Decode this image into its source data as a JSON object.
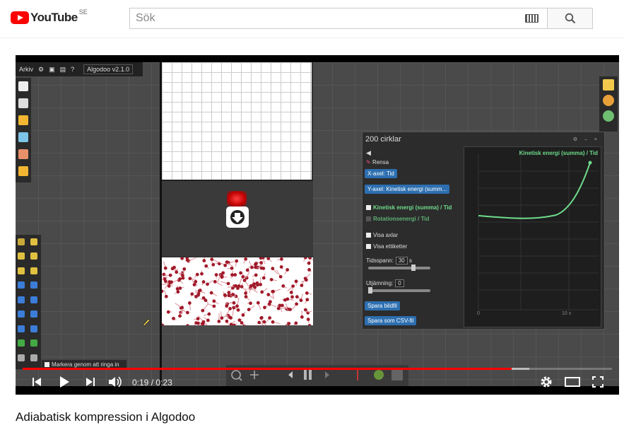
{
  "header": {
    "logo_text": "YouTube",
    "region": "SE",
    "search_placeholder": "Sök"
  },
  "video": {
    "title": "Adiabatisk kompression i Algodoo",
    "current_time": "0:19",
    "duration": "0:23",
    "time_separator": "/",
    "progress_fraction": 0.83,
    "buffered_fraction": 0.86,
    "colors": {
      "progress": "#ff0000",
      "brand": "#ff0000"
    }
  },
  "algodoo": {
    "menu_label": "Arkiv",
    "version": "Algodoo v2.1.0",
    "marker_tip": "Markera genom att ringa in",
    "panel": {
      "title": "200 cirklar",
      "clear_label": "Rensa",
      "x_axis_btn": "X-axel: Tid",
      "y_axis_btn": "Y-axel: Kinetisk energi (summ...",
      "series1_label": "Kinetisk energi (summa) / Tid",
      "series2_label": "Rotationsenergi / Tid",
      "show_axes": "Visa axlar",
      "show_labels": "Visa ettiketter",
      "timespan_label": "Tidsspann:",
      "timespan_value": "30",
      "timespan_unit": "s",
      "smoothing_label": "Utjämning:",
      "smoothing_value": "0",
      "save_image": "Spara bildfil",
      "save_csv": "Spara som CSV-fil",
      "graph_legend": "Kinetisk energi (summa) / Tid",
      "x_tick_0": "0",
      "x_tick_10": "10 s"
    }
  }
}
